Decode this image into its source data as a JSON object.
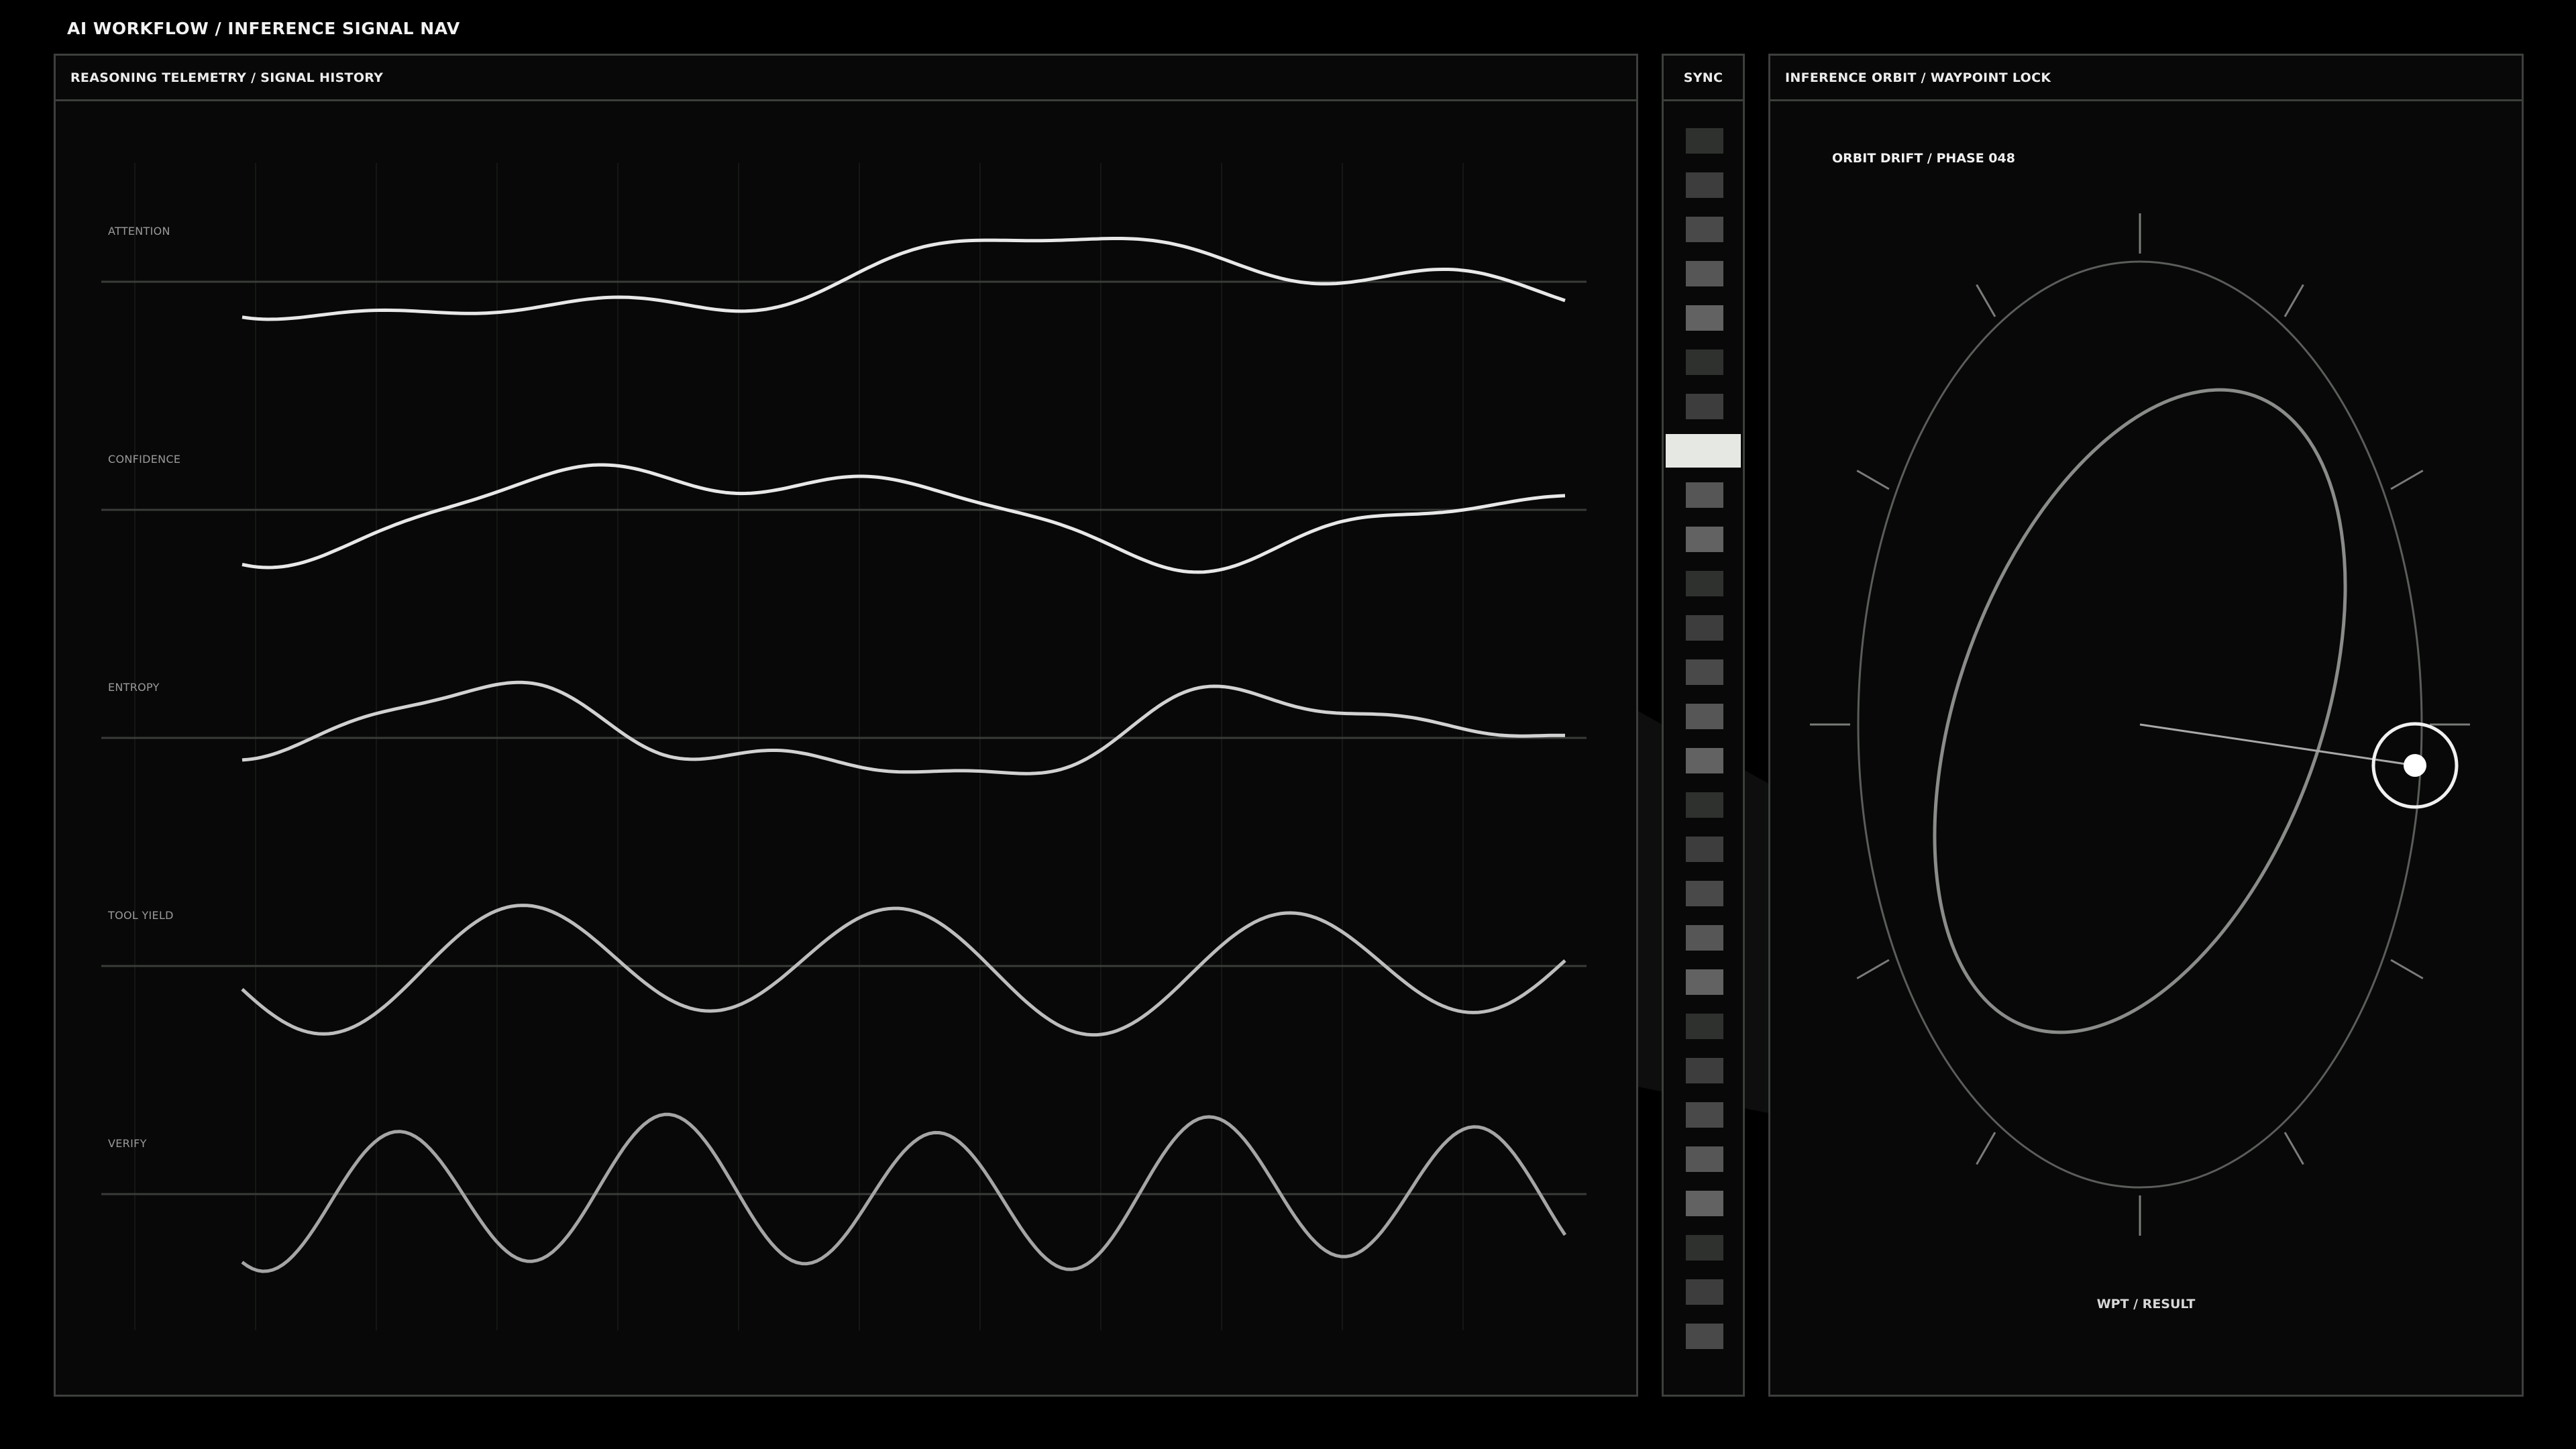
{
  "app": {
    "title": "AI WORKFLOW / INFERENCE SIGNAL NAV"
  },
  "telemetry": {
    "title": "REASONING TELEMETRY / SIGNAL HISTORY",
    "signals": [
      {
        "label": "ATTENTION"
      },
      {
        "label": "CONFIDENCE"
      },
      {
        "label": "ENTROPY"
      },
      {
        "label": "TOOL YIELD"
      },
      {
        "label": "VERIFY"
      }
    ]
  },
  "sync": {
    "title": "SYNC",
    "cells": [
      {
        "level": 0.15
      },
      {
        "level": 0.25
      },
      {
        "level": 0.35
      },
      {
        "level": 0.45
      },
      {
        "level": 0.55
      },
      {
        "level": 0.15
      },
      {
        "level": 0.25
      },
      {
        "level": 1.0,
        "active": true
      },
      {
        "level": 0.45
      },
      {
        "level": 0.55
      },
      {
        "level": 0.15
      },
      {
        "level": 0.25
      },
      {
        "level": 0.35
      },
      {
        "level": 0.45
      },
      {
        "level": 0.55
      },
      {
        "level": 0.15
      },
      {
        "level": 0.25
      },
      {
        "level": 0.35
      },
      {
        "level": 0.45
      },
      {
        "level": 0.55
      },
      {
        "level": 0.15
      },
      {
        "level": 0.25
      },
      {
        "level": 0.35
      },
      {
        "level": 0.45
      },
      {
        "level": 0.55
      },
      {
        "level": 0.15
      },
      {
        "level": 0.25
      },
      {
        "level": 0.35
      }
    ],
    "colors": {
      "base": "#1c1e1c",
      "high": "#9a9a9a",
      "active": "#e6e8e4"
    }
  },
  "orbit": {
    "title": "INFERENCE ORBIT / WAYPOINT LOCK",
    "subtitle": "ORBIT DRIFT / PHASE 048",
    "footer": "WPT / RESULT"
  }
}
